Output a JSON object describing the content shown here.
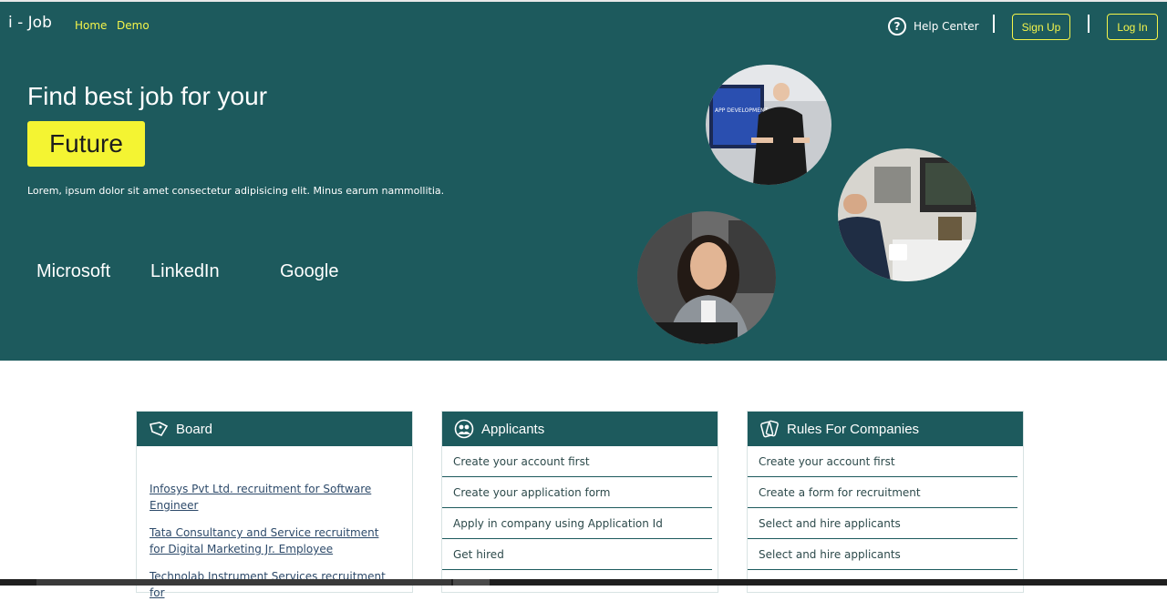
{
  "header": {
    "brand": "i - Job",
    "nav": [
      "Home",
      "Demo"
    ],
    "help_label": "Help Center",
    "signup_label": "Sign Up",
    "login_label": "Log In"
  },
  "hero": {
    "headline": "Find best job for your",
    "highlight": "Future",
    "subtext": "Lorem, ipsum dolor sit amet consectetur adipisicing elit. Minus earum nammollitia.",
    "companies": [
      "Microsoft",
      "LinkedIn",
      "Google"
    ],
    "photo_text": "APP DEVELOPMENT"
  },
  "cards": {
    "board": {
      "title": "Board",
      "links": [
        "Infosys Pvt Ltd. recruitment for Software Engineer",
        "Tata Consultancy and Service recruitment for Digital Marketing Jr. Employee",
        "Technolab Instrument Services recruitment for"
      ]
    },
    "applicants": {
      "title": "Applicants",
      "items": [
        "Create your account first",
        "Create your application form",
        "Apply in company using Application Id",
        "Get hired"
      ]
    },
    "rules": {
      "title": "Rules For Companies",
      "items": [
        "Create your account first",
        "Create a form for recruitment",
        "Select and hire applicants",
        "Select and hire applicants"
      ]
    }
  },
  "colors": {
    "primary": "#1d5a5d",
    "accent": "#f4f432",
    "white": "#ffffff"
  }
}
